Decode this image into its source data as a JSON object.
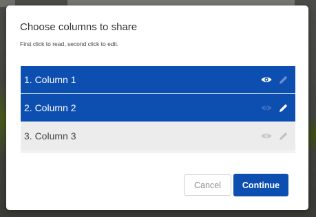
{
  "dialog": {
    "title": "Choose columns to share",
    "subtitle": "First click to read, second click to edit."
  },
  "columns": [
    {
      "label": "1. Column 1",
      "state": "read",
      "eye": "eye-icon",
      "edit": "pencil-icon"
    },
    {
      "label": "2. Column 2",
      "state": "edit",
      "eye": "eye-icon",
      "edit": "pencil-icon"
    },
    {
      "label": "3. Column 3",
      "state": "none",
      "eye": "eye-icon",
      "edit": "pencil-icon"
    }
  ],
  "buttons": {
    "cancel_label": "Cancel",
    "continue_label": "Continue"
  },
  "colors": {
    "accent": "#0d4fb0",
    "unselected_row": "#ececec",
    "icon_active": "#ffffff",
    "icon_faded_on_blue": "#6f8fcf",
    "icon_faded_on_gray": "#b5b5b5"
  }
}
